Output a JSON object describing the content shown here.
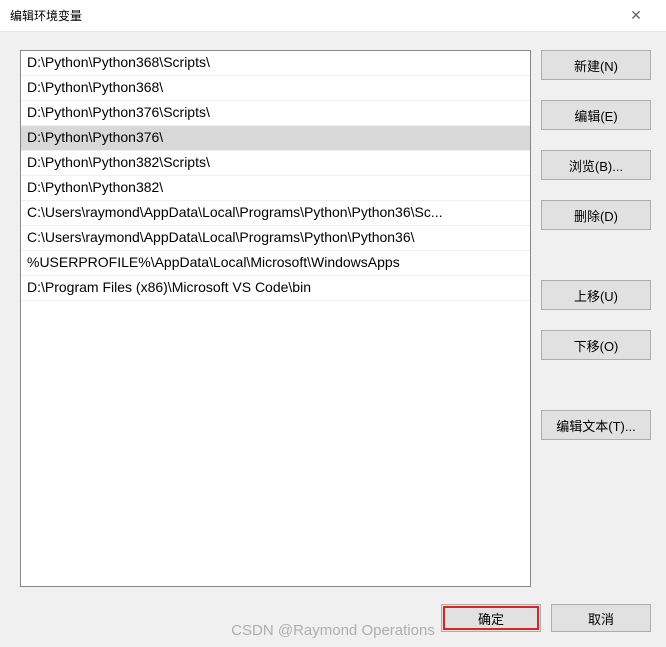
{
  "window": {
    "title": "编辑环境变量",
    "close_icon": "✕"
  },
  "list": {
    "items": [
      "D:\\Python\\Python368\\Scripts\\",
      "D:\\Python\\Python368\\",
      "D:\\Python\\Python376\\Scripts\\",
      "D:\\Python\\Python376\\",
      "D:\\Python\\Python382\\Scripts\\",
      "D:\\Python\\Python382\\",
      "C:\\Users\\raymond\\AppData\\Local\\Programs\\Python\\Python36\\Sc...",
      "C:\\Users\\raymond\\AppData\\Local\\Programs\\Python\\Python36\\",
      "%USERPROFILE%\\AppData\\Local\\Microsoft\\WindowsApps",
      "D:\\Program Files (x86)\\Microsoft VS Code\\bin"
    ],
    "selected_index": 3
  },
  "buttons": {
    "new": "新建(N)",
    "edit": "编辑(E)",
    "browse": "浏览(B)...",
    "delete": "删除(D)",
    "move_up": "上移(U)",
    "move_down": "下移(O)",
    "edit_text": "编辑文本(T)...",
    "ok": "确定",
    "cancel": "取消"
  },
  "watermark": "CSDN @Raymond Operations"
}
